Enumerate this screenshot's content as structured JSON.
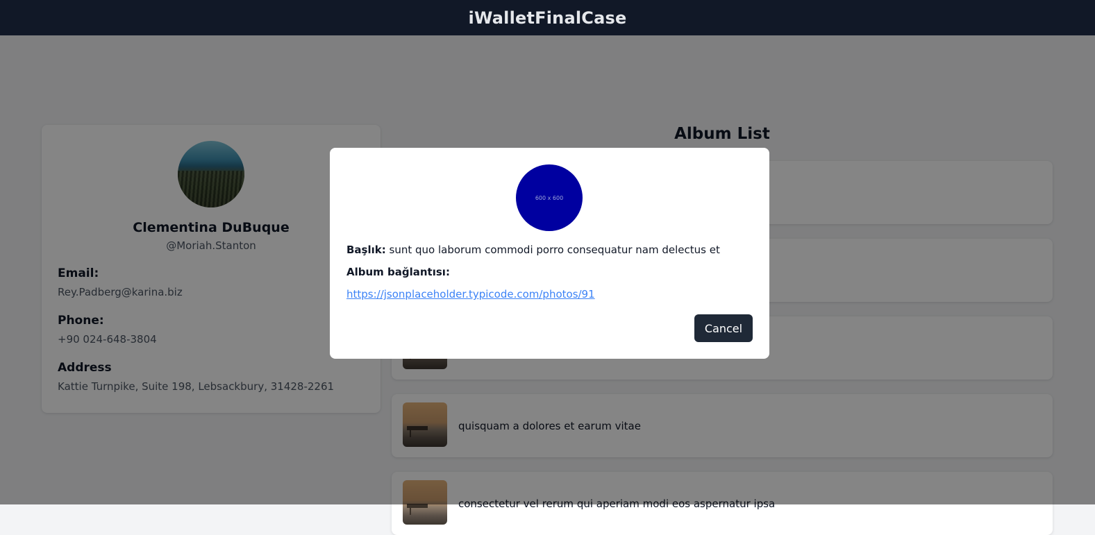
{
  "app": {
    "title": "iWalletFinalCase"
  },
  "profile": {
    "name": "Clementina DuBuque",
    "username": "@Moriah.Stanton",
    "email_label": "Email:",
    "email": "Rey.Padberg@karina.biz",
    "phone_label": "Phone:",
    "phone": "+90 024-648-3804",
    "address_label": "Address",
    "address": "Kattie Turnpike, Suite 198, Lebsackbury, 31428-2261"
  },
  "albums": {
    "title": "Album List",
    "items": [
      {
        "title": ""
      },
      {
        "title": ""
      },
      {
        "title": ""
      },
      {
        "title": "quisquam a dolores et earum vitae"
      },
      {
        "title": "consectetur vel rerum qui aperiam modi eos aspernatur ipsa"
      }
    ]
  },
  "modal": {
    "image_placeholder": "600 x 600",
    "image_color": "#0000a0",
    "title_label": "Başlık:",
    "title_value": "sunt quo laborum commodi porro consequatur nam delectus et",
    "link_label": "Album bağlantısı:",
    "link_url": "https://jsonplaceholder.typicode.com/photos/91",
    "cancel_label": "Cancel"
  }
}
